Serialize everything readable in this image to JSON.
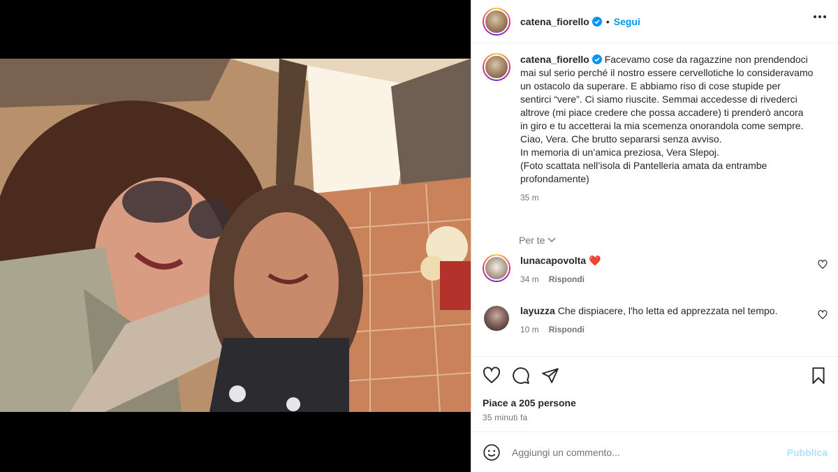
{
  "post": {
    "username": "catena_fiorello",
    "dot": "•",
    "follow_label": "Segui",
    "caption": "Facevamo cose da ragazzine non prendendoci mai sul serio perché il nostro essere cervellotiche lo consideravamo un ostacolo da superare. E abbiamo riso di cose stupide per sentirci “vere”. Ci siamo riuscite. Semmai accedesse di rivederci altrove (mi piace credere che possa accadere) ti prenderò ancora in giro e tu accetterai la mia scemenza onorandola come sempre. Ciao, Vera. Che brutto separarsi senza avviso.\nIn memoria di un’amica preziosa, Vera Slepoj.\n(Foto scattata nell’isola di Pantelleria amata da entrambe profondamente)",
    "caption_time": "35 m",
    "per_te_label": "Per te",
    "likes_text": "Piace a 205 persone",
    "posted_ago": "35 minuti fa"
  },
  "comments": [
    {
      "username": "lunacapovolta",
      "text": "❤️",
      "time": "34 m",
      "reply_label": "Rispondi"
    },
    {
      "username": "layuzza",
      "text": "Che dispiacere, l'ho letta ed apprezzata nel tempo.",
      "time": "10 m",
      "reply_label": "Rispondi"
    }
  ],
  "add_comment": {
    "placeholder": "Aggiungi un commento...",
    "publish_label": "Pubblica"
  },
  "colors": {
    "accent": "#0095f6",
    "publish_disabled": "#b2dffc",
    "muted": "#737373",
    "verified": "#0095f6"
  }
}
